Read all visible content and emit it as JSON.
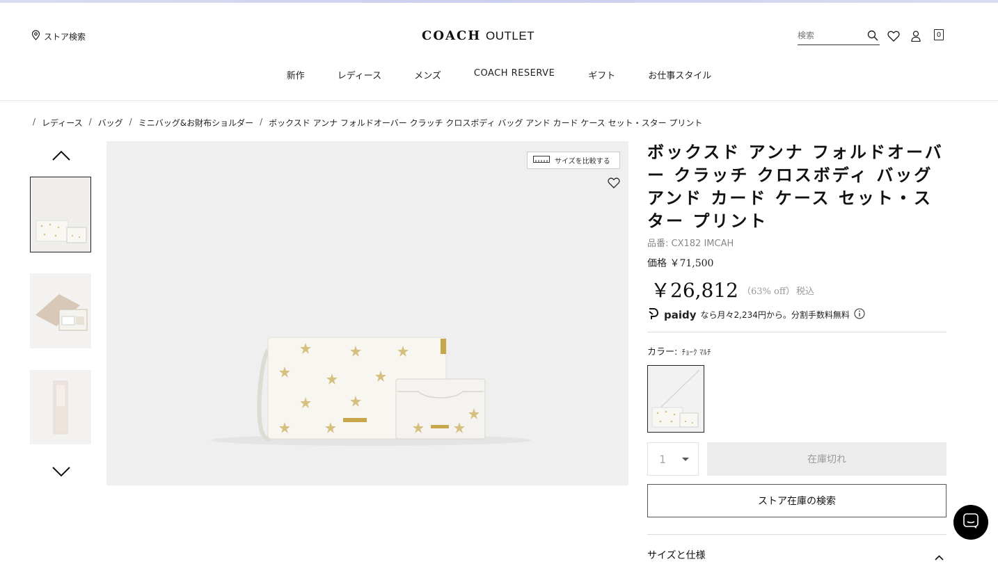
{
  "header": {
    "store_locator": "ストア検索",
    "logo_main": "COACH",
    "logo_sub": "OUTLET",
    "search_placeholder": "検索",
    "cart_count": "0"
  },
  "nav": {
    "items": [
      "新作",
      "レディース",
      "メンズ",
      "COACH RESERVE",
      "ギフト",
      "お仕事スタイル"
    ]
  },
  "breadcrumb": [
    "レディース",
    "バッグ",
    "ミニバッグ&お財布ショルダー",
    "ボックスド アンナ フォルドオーバー クラッチ クロスボディ バッグ アンド カード ケース セット・スター プリント"
  ],
  "gallery": {
    "compare_label": "サイズを比較する"
  },
  "product": {
    "title": "ボックスド アンナ フォルドオーバー クラッチ クロスボディ バッグ アンド カード ケース セット・スター プリント",
    "sku": "品番: CX182 IMCAH",
    "original_price": "価格 ￥71,500",
    "sale_price": "￥26,812",
    "discount": "（63% off）",
    "tax_label": "税込",
    "paidy_brand": "paidy",
    "paidy_text": "なら月々2,234円から。分割手数料無料",
    "color_label": "カラー:",
    "color_value": "ﾁｮｰｸ ﾏﾙﾁ",
    "quantity": "1",
    "soldout_label": "在庫切れ",
    "store_stock_label": "ストア在庫の検索",
    "size_spec_label": "サイズと仕様"
  },
  "colors": {
    "accent": "#111111",
    "topbar": "#d3d8f0",
    "image_bg": "#efefef",
    "disabled_bg": "#ececec"
  }
}
